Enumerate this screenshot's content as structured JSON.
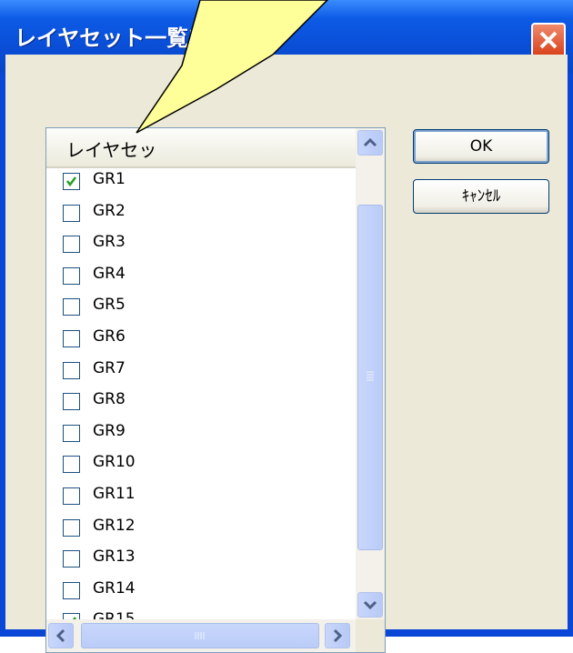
{
  "window": {
    "title": "レイヤセット一覧マ",
    "close_icon": "close-icon"
  },
  "list": {
    "header": "レイヤセッ",
    "items": [
      {
        "label": "GR1",
        "checked": true
      },
      {
        "label": "GR2",
        "checked": false
      },
      {
        "label": "GR3",
        "checked": false
      },
      {
        "label": "GR4",
        "checked": false
      },
      {
        "label": "GR5",
        "checked": false
      },
      {
        "label": "GR6",
        "checked": false
      },
      {
        "label": "GR7",
        "checked": false
      },
      {
        "label": "GR8",
        "checked": false
      },
      {
        "label": "GR9",
        "checked": false
      },
      {
        "label": "GR10",
        "checked": false
      },
      {
        "label": "GR11",
        "checked": false
      },
      {
        "label": "GR12",
        "checked": false
      },
      {
        "label": "GR13",
        "checked": false
      },
      {
        "label": "GR14",
        "checked": false
      },
      {
        "label": "GR15",
        "checked": true
      }
    ]
  },
  "buttons": {
    "ok": "OK",
    "cancel": "ｷｬﾝｾﾙ"
  },
  "colors": {
    "titlebar": "#0a4fd8",
    "client": "#ece9d8",
    "check": "#21a121",
    "close": "#d8411a",
    "bubble": "#ffff99"
  }
}
